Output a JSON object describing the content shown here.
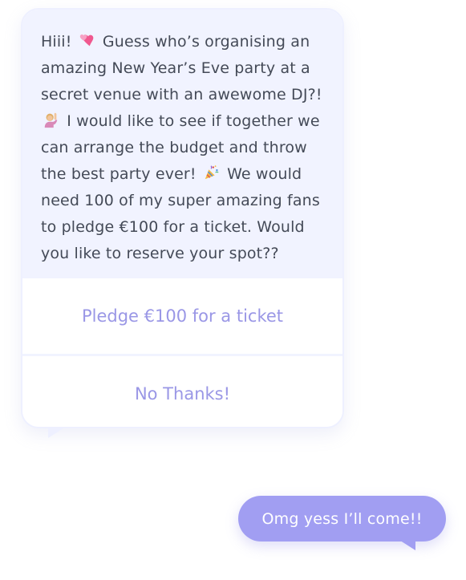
{
  "incoming": {
    "segments": [
      "Hiii!",
      "Guess who’s organising an amazing New Year’s Eve party at a secret venue with an awewome DJ?!",
      "I would like to see if together we can arrange the budget and throw the best party ever!",
      "We would need 100 of my super amazing fans to pledge €100 for a ticket. Would you like to reserve your spot??"
    ],
    "emojis": [
      "two-hearts-icon",
      "person-raising-hand-icon",
      "party-popper-icon"
    ],
    "actions": {
      "pledge": "Pledge €100 for a ticket",
      "decline": "No Thanks!"
    }
  },
  "reply": {
    "text": "Omg yess I’ll come!!"
  },
  "colors": {
    "card_background": "#f1f3ff",
    "action_text": "#9a97e6",
    "message_text": "#444a57",
    "reply_bubble": "#a19ef2",
    "reply_text": "#ffffff"
  }
}
